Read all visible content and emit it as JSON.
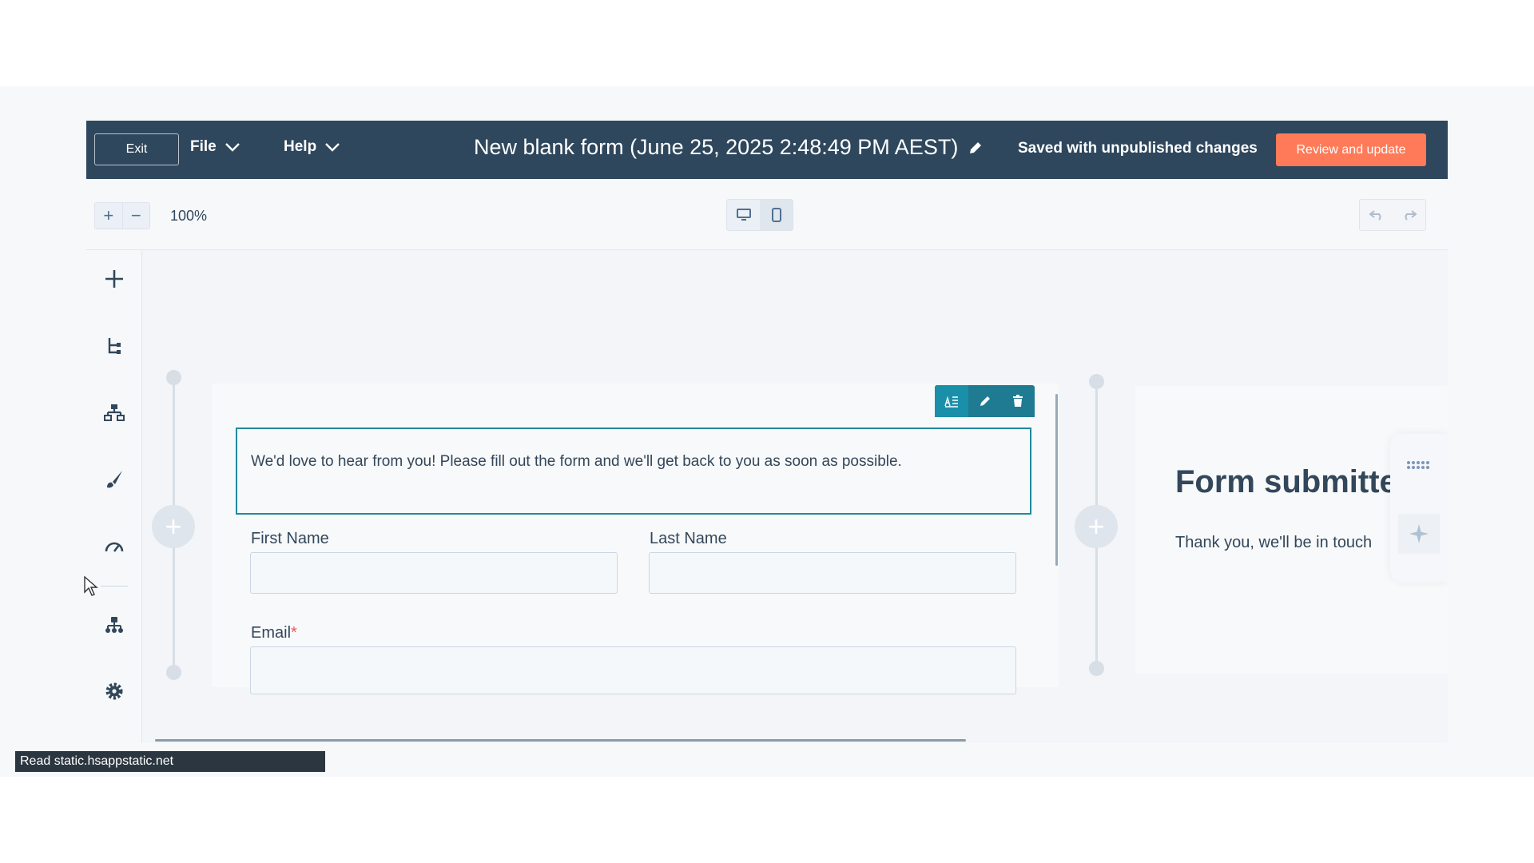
{
  "header": {
    "exit_label": "Exit",
    "menus": [
      {
        "label": "File"
      },
      {
        "label": "Help"
      }
    ],
    "form_title": "New blank form (June 25, 2025 2:48:49 PM AEST)",
    "save_status": "Saved with unpublished changes",
    "review_label": "Review and update"
  },
  "toolbar": {
    "zoom_in": "+",
    "zoom_out": "−",
    "zoom_level": "100%",
    "active_device": "mobile"
  },
  "sidebar": {
    "items": [
      {
        "icon": "plus-icon"
      },
      {
        "icon": "tree-icon"
      },
      {
        "icon": "hierarchy-icon"
      },
      {
        "icon": "paintbrush-icon"
      },
      {
        "icon": "gauge-icon"
      },
      {
        "icon": "org-chart-icon"
      },
      {
        "icon": "gear-icon"
      }
    ]
  },
  "form": {
    "intro_text": "We'd love to hear from you! Please fill out the form and we'll get back to you as soon as possible.",
    "fields": {
      "first_name": "First Name",
      "last_name": "Last Name",
      "email": "Email",
      "required_mark": "*"
    }
  },
  "thank_you": {
    "title": "Form submitte",
    "text": "Thank you, we'll be in touch"
  },
  "status_bar": "Read static.hsappstatic.net",
  "colors": {
    "header_bg": "#2e475d",
    "accent": "#ff7a59",
    "selection": "#1f8aa0",
    "text": "#33475b"
  }
}
